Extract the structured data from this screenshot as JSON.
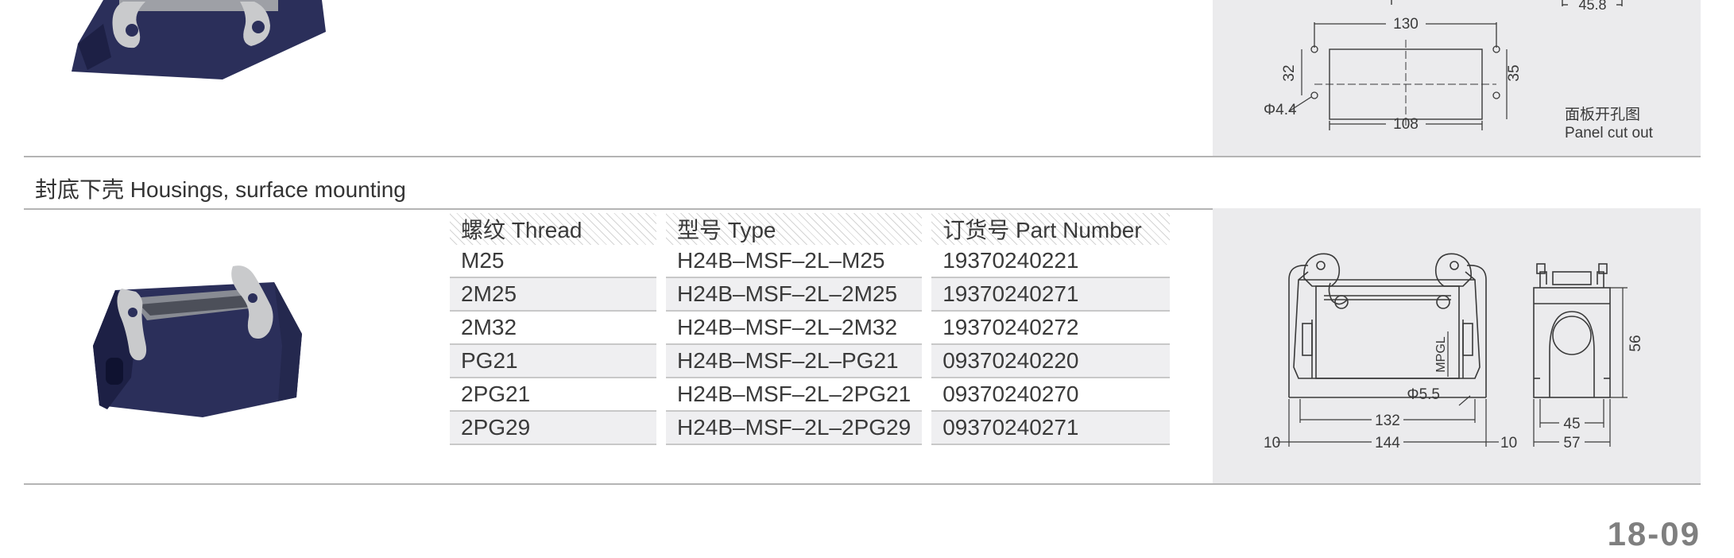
{
  "section": {
    "title": "封底下壳 Housings, surface mounting"
  },
  "table": {
    "headers": [
      "螺纹 Thread",
      "型号 Type",
      "订货号 Part Number"
    ],
    "rows": [
      [
        "M25",
        "H24B–MSF–2L–M25",
        "19370240221"
      ],
      [
        "2M25",
        "H24B–MSF–2L–2M25",
        "19370240271"
      ],
      [
        "2M32",
        "H24B–MSF–2L–2M32",
        "19370240272"
      ],
      [
        "PG21",
        "H24B–MSF–2L–PG21",
        "09370240220"
      ],
      [
        "2PG21",
        "H24B–MSF–2L–2PG21",
        "09370240270"
      ],
      [
        "2PG29",
        "H24B–MSF–2L–2PG29",
        "09370240271"
      ]
    ]
  },
  "top_drawing": {
    "dims": {
      "d45_8": "45.8",
      "d130": "130",
      "d32": "32",
      "d35": "35",
      "d108": "108",
      "hole": "Φ4.4"
    },
    "caption_cn": "面板开孔图",
    "caption_en": "Panel cut out"
  },
  "bottom_drawing": {
    "dims": {
      "d56": "56",
      "d132": "132",
      "d144": "144",
      "d10_left": "10",
      "d10_right": "10",
      "hole": "Φ5.5",
      "mpg": "MPGL",
      "d45": "45",
      "d57": "57"
    }
  },
  "footer": {
    "page_number": "18-09"
  },
  "colors": {
    "panel_bg": "#ebebed",
    "rule": "#b4b4b4",
    "housing_body": "#2b2f5a",
    "lever": "#c9cacc"
  }
}
